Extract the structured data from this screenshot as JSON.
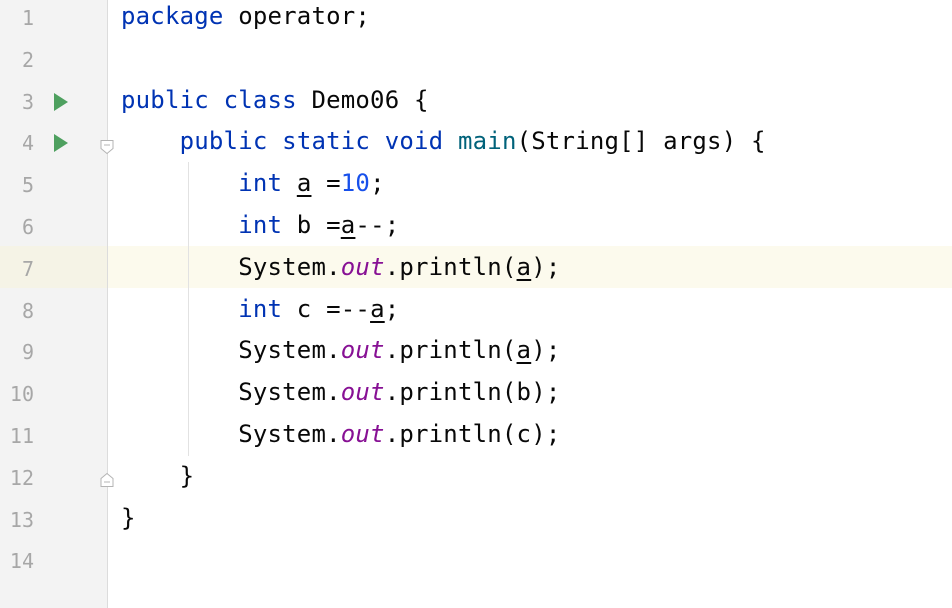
{
  "editor": {
    "current_line": 7,
    "lines": [
      {
        "number": "1",
        "tokens": [
          {
            "t": "package",
            "c": "kw"
          },
          {
            "t": " operator;",
            "c": ""
          }
        ]
      },
      {
        "number": "2",
        "tokens": []
      },
      {
        "number": "3",
        "run_icon": "run-icon",
        "tokens": [
          {
            "t": "public",
            "c": "kw"
          },
          {
            "t": " ",
            "c": ""
          },
          {
            "t": "class",
            "c": "kw"
          },
          {
            "t": " Demo06 {",
            "c": ""
          }
        ]
      },
      {
        "number": "4",
        "run_icon": "run-icon",
        "fold_icon": "fold-open-icon",
        "tokens": [
          {
            "t": "    ",
            "c": ""
          },
          {
            "t": "public",
            "c": "kw"
          },
          {
            "t": " ",
            "c": ""
          },
          {
            "t": "static",
            "c": "kw"
          },
          {
            "t": " ",
            "c": ""
          },
          {
            "t": "void",
            "c": "kw"
          },
          {
            "t": " ",
            "c": ""
          },
          {
            "t": "main",
            "c": "mth"
          },
          {
            "t": "(String[] args) {",
            "c": ""
          }
        ]
      },
      {
        "number": "5",
        "tokens": [
          {
            "t": "        ",
            "c": ""
          },
          {
            "t": "int",
            "c": "kw"
          },
          {
            "t": " ",
            "c": ""
          },
          {
            "t": "a",
            "c": "uvar"
          },
          {
            "t": " =",
            "c": ""
          },
          {
            "t": "10",
            "c": "num"
          },
          {
            "t": ";",
            "c": ""
          }
        ]
      },
      {
        "number": "6",
        "tokens": [
          {
            "t": "        ",
            "c": ""
          },
          {
            "t": "int",
            "c": "kw"
          },
          {
            "t": " b =",
            "c": ""
          },
          {
            "t": "a",
            "c": "uvar"
          },
          {
            "t": "--;",
            "c": ""
          }
        ]
      },
      {
        "number": "7",
        "tokens": [
          {
            "t": "        System.",
            "c": ""
          },
          {
            "t": "out",
            "c": "fld"
          },
          {
            "t": ".println(",
            "c": ""
          },
          {
            "t": "a",
            "c": "uvar"
          },
          {
            "t": ");",
            "c": ""
          }
        ]
      },
      {
        "number": "8",
        "tokens": [
          {
            "t": "        ",
            "c": ""
          },
          {
            "t": "int",
            "c": "kw"
          },
          {
            "t": " c =--",
            "c": ""
          },
          {
            "t": "a",
            "c": "uvar"
          },
          {
            "t": ";",
            "c": ""
          }
        ]
      },
      {
        "number": "9",
        "tokens": [
          {
            "t": "        System.",
            "c": ""
          },
          {
            "t": "out",
            "c": "fld"
          },
          {
            "t": ".println(",
            "c": ""
          },
          {
            "t": "a",
            "c": "uvar"
          },
          {
            "t": ");",
            "c": ""
          }
        ]
      },
      {
        "number": "10",
        "tokens": [
          {
            "t": "        System.",
            "c": ""
          },
          {
            "t": "out",
            "c": "fld"
          },
          {
            "t": ".println(b);",
            "c": ""
          }
        ]
      },
      {
        "number": "11",
        "tokens": [
          {
            "t": "        System.",
            "c": ""
          },
          {
            "t": "out",
            "c": "fld"
          },
          {
            "t": ".println(c);",
            "c": ""
          }
        ]
      },
      {
        "number": "12",
        "fold_icon": "fold-close-icon",
        "tokens": [
          {
            "t": "    }",
            "c": ""
          }
        ]
      },
      {
        "number": "13",
        "tokens": [
          {
            "t": "}",
            "c": ""
          }
        ]
      },
      {
        "number": "14",
        "tokens": []
      }
    ]
  },
  "colors": {
    "keyword": "#0033b3",
    "number": "#1750eb",
    "static_field": "#871094",
    "method": "#00627a",
    "run_icon": "#4ea05f",
    "current_line_bg": "#fcfaed"
  }
}
